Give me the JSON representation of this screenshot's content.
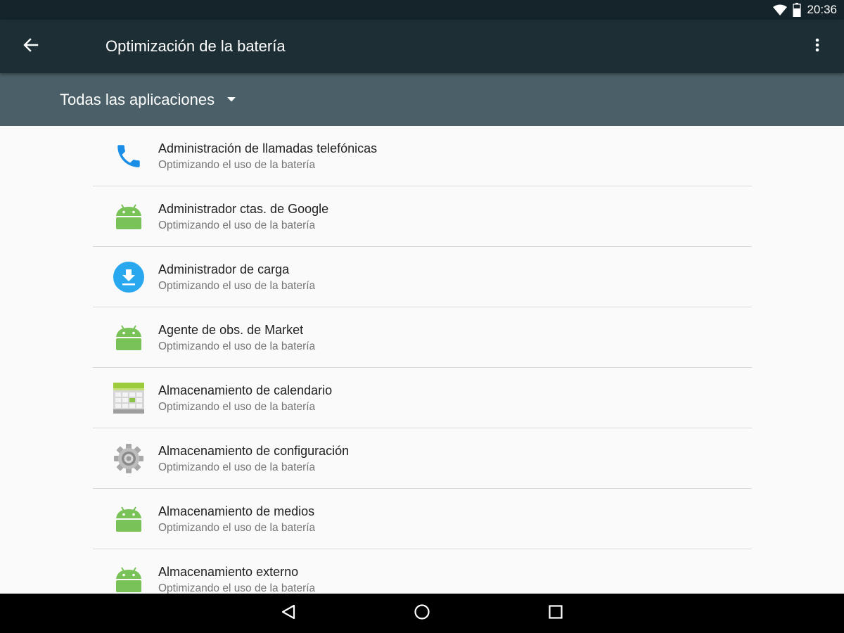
{
  "status_bar": {
    "time": "20:36",
    "wifi_icon": "wifi-icon",
    "battery_icon": "battery-icon"
  },
  "app_bar": {
    "title": "Optimización de la batería",
    "back_icon": "arrow-back-icon",
    "overflow_icon": "more-vert-icon",
    "background": "#1d2f35"
  },
  "filter": {
    "selected": "Todas las aplicaciones",
    "arrow_icon": "dropdown-arrow-icon",
    "background": "#4a5f67"
  },
  "apps": [
    {
      "name": "Administración de llamadas telefónicas",
      "status": "Optimizando el uso de la batería",
      "icon": "phone-icon"
    },
    {
      "name": "Administrador ctas. de Google",
      "status": "Optimizando el uso de la batería",
      "icon": "android-icon"
    },
    {
      "name": "Administrador de carga",
      "status": "Optimizando el uso de la batería",
      "icon": "download-icon"
    },
    {
      "name": "Agente de obs. de Market",
      "status": "Optimizando el uso de la batería",
      "icon": "android-icon"
    },
    {
      "name": "Almacenamiento de calendario",
      "status": "Optimizando el uso de la batería",
      "icon": "calendar-icon"
    },
    {
      "name": "Almacenamiento de configuración",
      "status": "Optimizando el uso de la batería",
      "icon": "gear-icon"
    },
    {
      "name": "Almacenamiento de medios",
      "status": "Optimizando el uso de la batería",
      "icon": "android-icon"
    },
    {
      "name": "Almacenamiento externo",
      "status": "Optimizando el uso de la batería",
      "icon": "android-icon"
    }
  ],
  "nav_bar": {
    "back_icon": "nav-back-icon",
    "home_icon": "nav-home-icon",
    "recents_icon": "nav-recents-icon"
  },
  "colors": {
    "android_green": "#78c257",
    "phone_blue": "#1b8ee8",
    "download_blue": "#29a8f0"
  }
}
